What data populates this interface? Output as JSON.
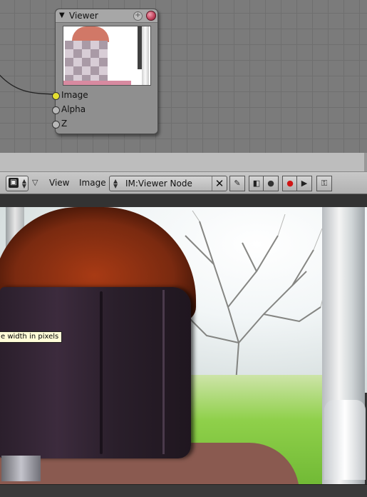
{
  "node_editor": {
    "node": {
      "title": "Viewer",
      "collapse_icon": "triangle-down",
      "add_icon": "plus",
      "sockets": [
        {
          "label": "Image",
          "color": "#e5e031"
        },
        {
          "label": "Alpha",
          "color": "#b8b8b8"
        },
        {
          "label": "Z",
          "color": "#b8b8b8"
        }
      ]
    }
  },
  "image_editor": {
    "header": {
      "editor_type_icon": "image-editor-icon",
      "menus": [
        "View",
        "Image"
      ],
      "image_name": "IM:Viewer Node",
      "clear_label": "✕",
      "tools": [
        {
          "name": "paint-brush-icon",
          "glyph": "✎"
        },
        {
          "name": "view-mode-icon",
          "glyph": "◧"
        },
        {
          "name": "dot-icon",
          "glyph": "●"
        },
        {
          "name": "record-icon",
          "glyph": "●"
        },
        {
          "name": "play-icon",
          "glyph": "▶"
        },
        {
          "name": "lock-icon",
          "glyph": "🔓"
        }
      ]
    },
    "tooltip": "e width in pixels"
  }
}
